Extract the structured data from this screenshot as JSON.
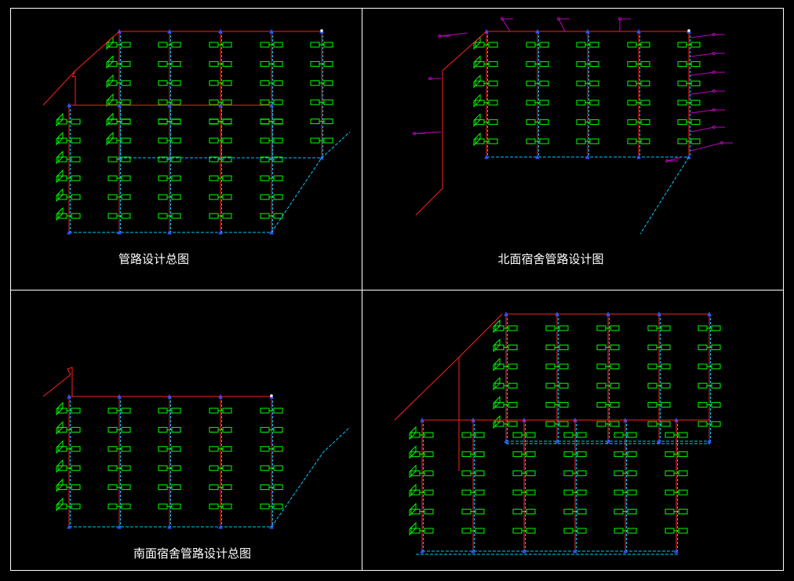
{
  "titles": {
    "panel1": "管路设计总图",
    "panel2": "北面宿舍管路设计图",
    "panel3": "南面宿舍管路设计总图"
  },
  "colors": {
    "background": "#000000",
    "frame": "#ffffff",
    "supply_pipe": "#ff2020",
    "riser": "#ff2020",
    "return_pipe": "#00c8ff",
    "radiator": "#00ff00",
    "valve": "#3050ff",
    "annotation": "#c000c0"
  }
}
